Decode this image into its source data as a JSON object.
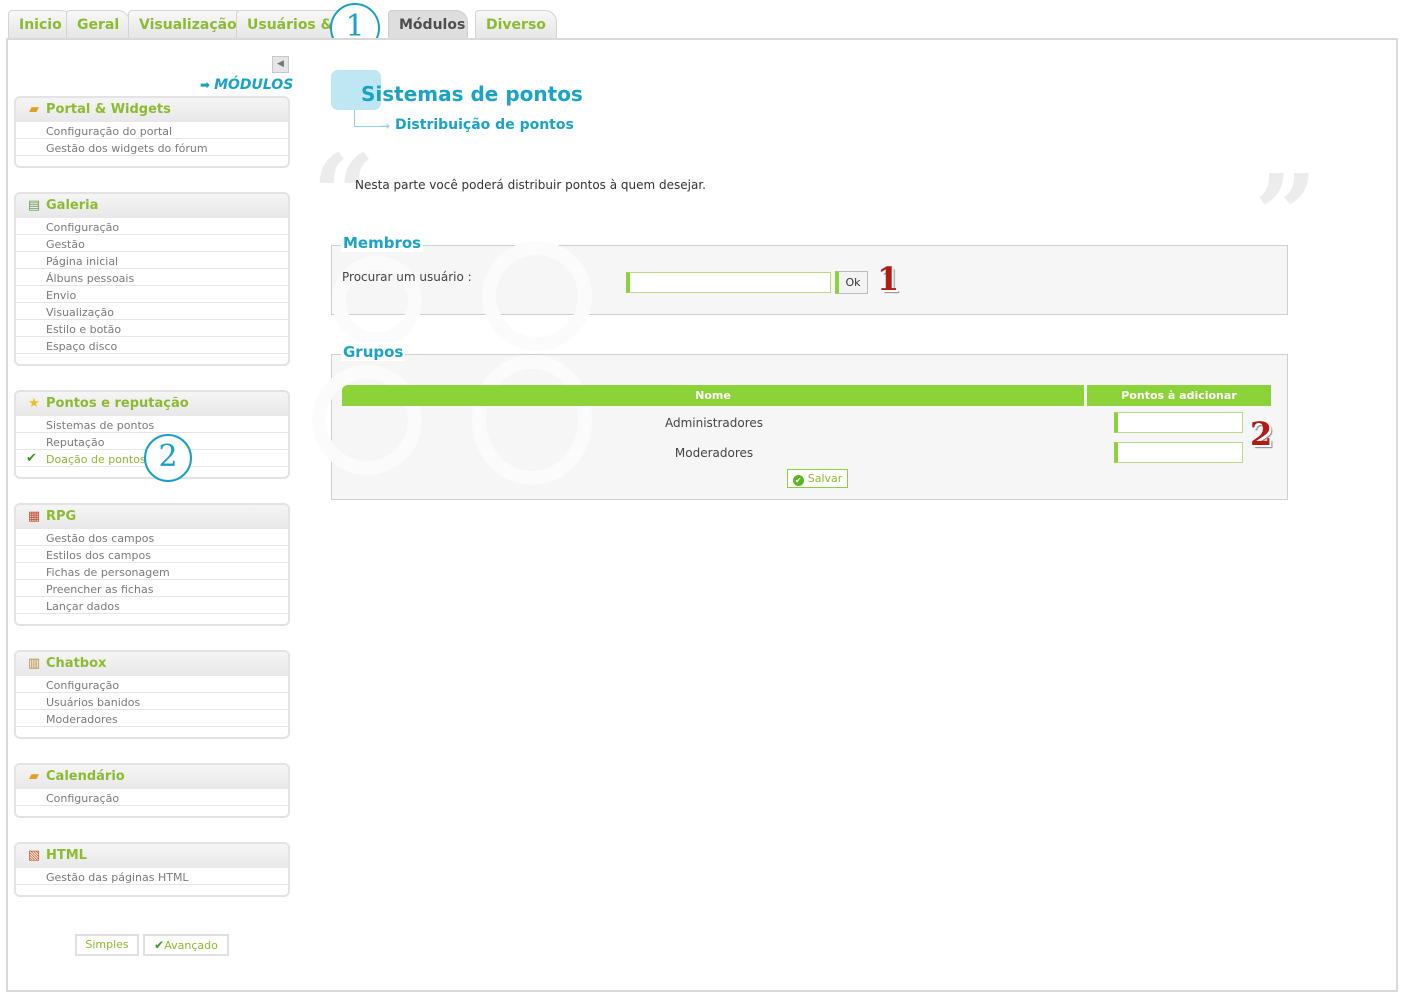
{
  "tabs": [
    {
      "label": "Inicio"
    },
    {
      "label": "Geral"
    },
    {
      "label": "Visualização"
    },
    {
      "label": "Usuários & G"
    },
    {
      "label": "Módulos"
    },
    {
      "label": "Diverso"
    }
  ],
  "annotations": {
    "one": "1",
    "two": "2"
  },
  "sidebar": {
    "heading": "MÓDULOS",
    "boxes": [
      {
        "title": "Portal & Widgets",
        "icon": "box-icon",
        "items": [
          "Configuração do portal",
          "Gestão dos widgets do fórum"
        ]
      },
      {
        "title": "Galeria",
        "icon": "gallery-icon",
        "items": [
          "Configuração",
          "Gestão",
          "Página inicial",
          "Álbuns pessoais",
          "Envio",
          "Visualização",
          "Estilo e botão",
          "Espaço disco"
        ]
      },
      {
        "title": "Pontos e reputação",
        "icon": "star-icon",
        "items": [
          "Sistemas de pontos",
          "Reputação",
          "Doação de pontos"
        ]
      },
      {
        "title": "RPG",
        "icon": "rpg-icon",
        "items": [
          "Gestão dos campos",
          "Estilos dos campos",
          "Fichas de personagem",
          "Preencher as fichas",
          "Lançar dados"
        ]
      },
      {
        "title": "Chatbox",
        "icon": "chatbox-icon",
        "items": [
          "Configuração",
          "Usuários banidos",
          "Moderadores"
        ]
      },
      {
        "title": "Calendário",
        "icon": "calendar-icon",
        "items": [
          "Configuração"
        ]
      },
      {
        "title": "HTML",
        "icon": "html-page-icon",
        "items": [
          "Gestão das páginas HTML"
        ]
      }
    ],
    "modes": {
      "simple": "Simples",
      "advanced": "Avançado"
    }
  },
  "main": {
    "title": "Sistemas de pontos",
    "subtitle": "Distribuição de pontos",
    "intro": "Nesta parte você poderá distribuir pontos à quem desejar.",
    "members": {
      "legend": "Membros",
      "search_label": "Procurar um usuário :",
      "search_value": "",
      "ok_label": "Ok"
    },
    "groups": {
      "legend": "Grupos",
      "col_name": "Nome",
      "col_points": "Pontos à adicionar",
      "rows": [
        {
          "name": "Administradores",
          "points": ""
        },
        {
          "name": "Moderadores",
          "points": ""
        }
      ],
      "save_label": "Salvar"
    }
  },
  "colors": {
    "accent_green": "#8cba32",
    "accent_blue": "#19a3c8",
    "annotation_red": "#b21a14"
  }
}
